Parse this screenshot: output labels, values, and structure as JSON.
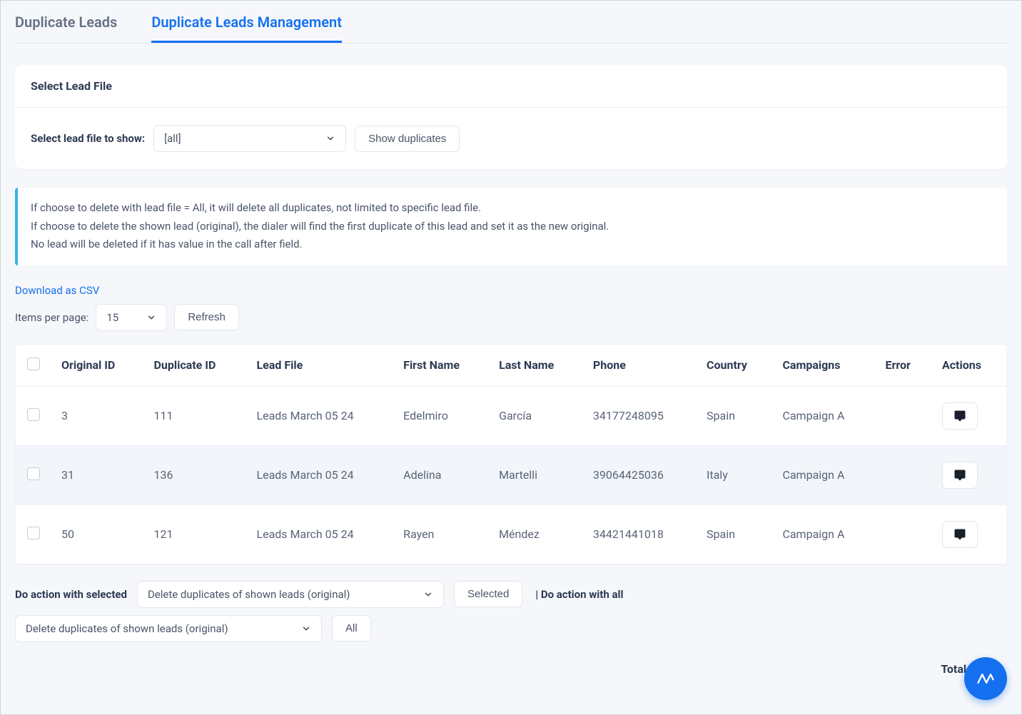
{
  "tabs": {
    "duplicate_leads": "Duplicate Leads",
    "duplicate_leads_management": "Duplicate Leads Management"
  },
  "select_card": {
    "title": "Select Lead File",
    "label": "Select lead file to show:",
    "value": "[all]",
    "show_btn": "Show duplicates"
  },
  "callout": {
    "line1": "If choose to delete with lead file = All, it will delete all duplicates, not limited to specific lead file.",
    "line2": "If choose to delete the shown lead (original), the dialer will find the first duplicate of this lead and set it as the new original.",
    "line3": "No lead will be deleted if it has value in the call after field."
  },
  "download_link": "Download as CSV",
  "items_per_page_label": "Items per page:",
  "items_per_page_value": "15",
  "refresh_btn": "Refresh",
  "table": {
    "headers": {
      "original_id": "Original ID",
      "duplicate_id": "Duplicate ID",
      "lead_file": "Lead File",
      "first_name": "First Name",
      "last_name": "Last Name",
      "phone": "Phone",
      "country": "Country",
      "campaigns": "Campaigns",
      "error": "Error",
      "actions": "Actions"
    },
    "rows": [
      {
        "original_id": "3",
        "duplicate_id": "111",
        "lead_file": "Leads March 05 24",
        "first_name": "Edelmiro",
        "last_name": "García",
        "phone": "34177248095",
        "country": "Spain",
        "campaigns": "Campaign A",
        "error": ""
      },
      {
        "original_id": "31",
        "duplicate_id": "136",
        "lead_file": "Leads March 05 24",
        "first_name": "Adelina",
        "last_name": "Martelli",
        "phone": "39064425036",
        "country": "Italy",
        "campaigns": "Campaign A",
        "error": ""
      },
      {
        "original_id": "50",
        "duplicate_id": "121",
        "lead_file": "Leads March 05 24",
        "first_name": "Rayen",
        "last_name": "Méndez",
        "phone": "34421441018",
        "country": "Spain",
        "campaigns": "Campaign A",
        "error": ""
      }
    ]
  },
  "bottom": {
    "do_selected_label": "Do action with selected",
    "action_selected_value": "Delete duplicates of shown leads (original)",
    "selected_btn": "Selected",
    "do_all_label": "| Do action with all",
    "action_all_value": "Delete duplicates of shown leads (original)",
    "all_btn": "All"
  },
  "total_label": "Total items:"
}
